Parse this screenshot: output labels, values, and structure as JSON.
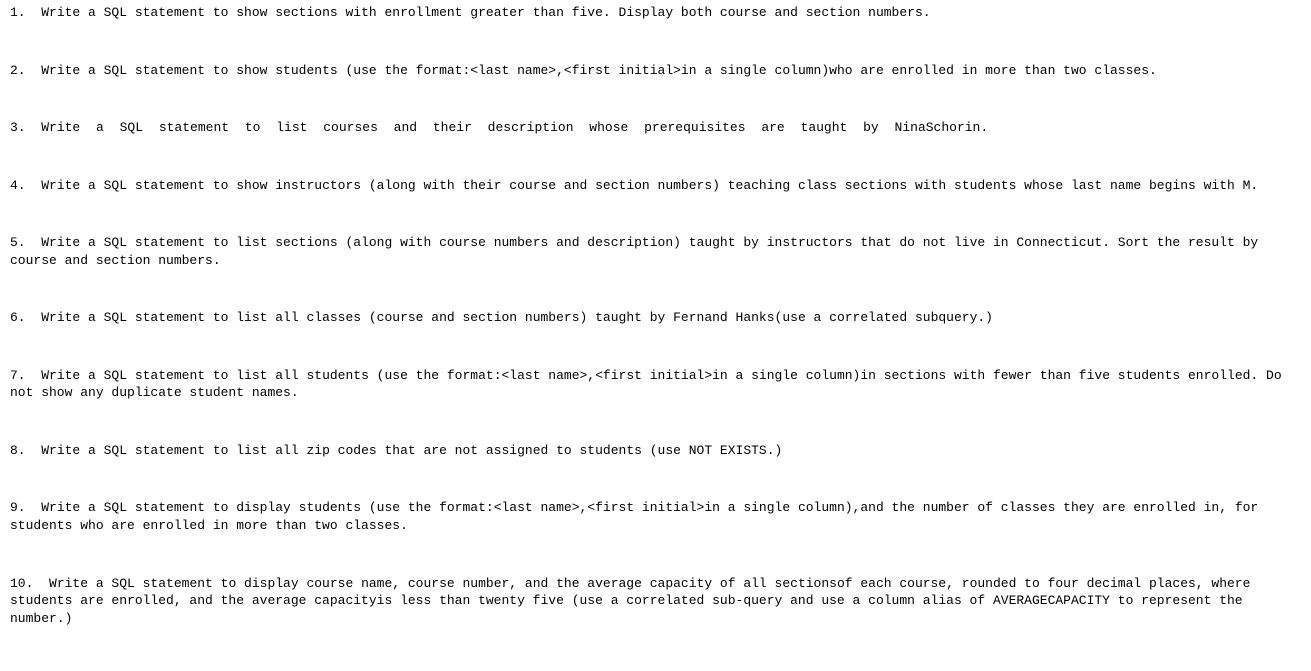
{
  "questions": [
    {
      "num": "1.",
      "text": "Write a SQL statement to show sections with enrollment greater than five. Display both course and section numbers."
    },
    {
      "num": "2.",
      "text": "Write a SQL statement to show students (use the format:<last name>,<first initial>in a single column)who are enrolled in more than two classes."
    },
    {
      "num": "3.",
      "text": "Write a SQL statement to list courses and their description whose prerequisites are taught by NinaSchorin.",
      "justified": true
    },
    {
      "num": "4.",
      "text": "Write a SQL statement to show instructors (along with their course and section numbers) teaching class sections with students whose last name begins with M."
    },
    {
      "num": "5.",
      "text": "Write a SQL statement to list sections (along with course numbers and description) taught by instructors that do not live in Connecticut. Sort the result by course and section numbers."
    },
    {
      "num": "6.",
      "text": "Write a SQL statement to list all classes (course and section numbers) taught by Fernand Hanks(use a correlated subquery.)"
    },
    {
      "num": "7.",
      "text": "Write a SQL statement to list all students (use the format:<last name>,<first initial>in a single column)in sections with fewer than five students enrolled. Do not show any duplicate student names."
    },
    {
      "num": "8.",
      "text": "Write a SQL statement to list all zip codes that are not assigned to students (use NOT EXISTS.)"
    },
    {
      "num": "9.",
      "text": "Write a SQL statement to display students (use the format:<last name>,<first initial>in a single column),and the number of classes they are enrolled in, for students who are enrolled in more than two classes."
    },
    {
      "num": "10.",
      "text": "Write a SQL statement to display course name, course number, and the average capacity of all sectionsof each course, rounded to four decimal places, where students are enrolled, and the average capacityis less than twenty five (use a correlated sub-query and use a column alias of AVERAGECAPACITY to represent the number.)"
    }
  ]
}
